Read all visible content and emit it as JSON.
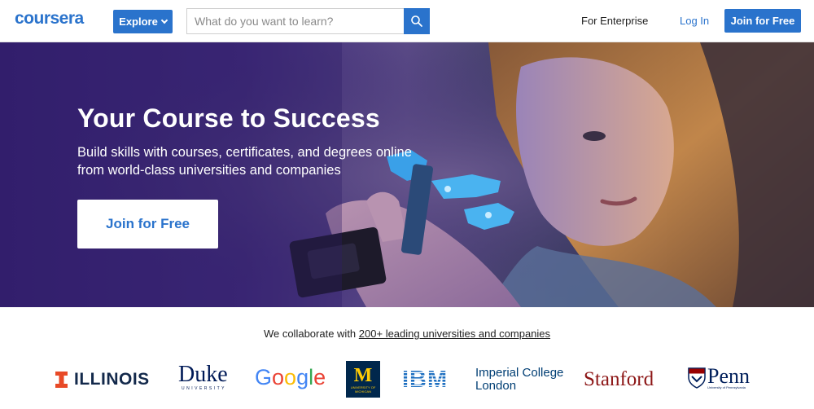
{
  "header": {
    "logo": "coursera",
    "explore_label": "Explore",
    "search_placeholder": "What do you want to learn?",
    "enterprise_label": "For Enterprise",
    "login_label": "Log In",
    "join_label": "Join for Free"
  },
  "hero": {
    "title": "Your Course to Success",
    "subtitle": "Build skills with courses, certificates, and degrees online from world-class universities and companies",
    "cta_label": "Join for Free"
  },
  "partners": {
    "intro": "We collaborate with",
    "link_text": "200+ leading universities and companies",
    "logos": {
      "illinois": "ILLINOIS",
      "duke": "Duke",
      "duke_sub": "UNIVERSITY",
      "google": "Google",
      "michigan": "M",
      "michigan_sub": "UNIVERSITY OF MICHIGAN",
      "ibm": "IBM",
      "imperial_line1": "Imperial College",
      "imperial_line2": "London",
      "stanford": "Stanford",
      "penn": "Penn",
      "penn_sub": "University of Pennsylvania"
    }
  },
  "colors": {
    "brand_blue": "#2a73cc",
    "hero_purple": "#35206f"
  }
}
